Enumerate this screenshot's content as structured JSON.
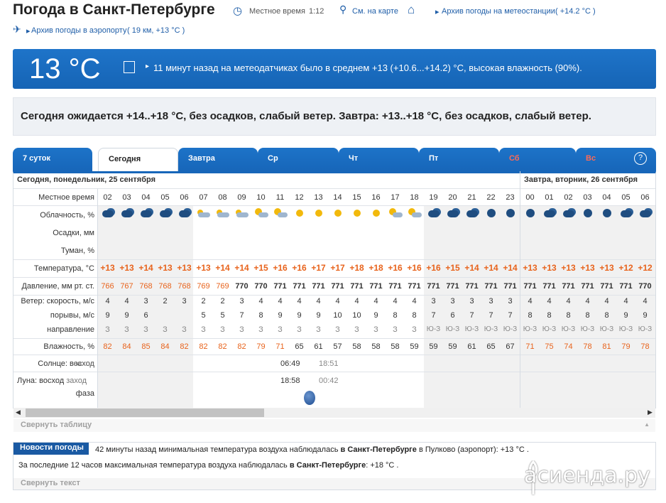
{
  "header": {
    "title": "Погода в Санкт-Петербурге",
    "local_time_label": "Местное время",
    "local_time": "1:12",
    "map_link": "См. на карте",
    "archive_station_link": "Архив погоды на метеостанции",
    "archive_station_temp": "( +14.2 °C )",
    "archive_airport_link": "Архив погоды в аэропорту",
    "archive_airport_note": "( 19 км, +13 °C )"
  },
  "current": {
    "temp": "13 °C",
    "text": "11 минут назад на метеодатчиках было в среднем +13 (+10.6...+14.2) °C, высокая влажность (90%)."
  },
  "forecast_text": "Сегодня ожидается +14..+18 °C, без осадков, слабый ветер. Завтра: +13..+18 °C, без осадков, слабый ветер.",
  "tabs": [
    "7 суток",
    "Сегодня",
    "Завтра",
    "Ср",
    "Чт",
    "Пт",
    "Сб",
    "Вс"
  ],
  "help_icon": "?",
  "table": {
    "day1_header": "Сегодня, понедельник, 25 сентября",
    "day2_header": "Завтра, вторник, 26 сентября",
    "row_labels": {
      "time": "Местное время",
      "clouds": "Облачность, %",
      "precip": "Осадки, мм",
      "fog": "Туман, %",
      "temp": "Температура, °C",
      "pressure": "Давление, мм рт. ст.",
      "wind_speed": "Ветер: скорость, м/с",
      "gusts": "порывы, м/с",
      "direction": "направление",
      "humidity": "Влажность, %",
      "sun_prefix": "Солнце:",
      "sun_rise": "восход",
      "sun_set": "заход",
      "moon_prefix": "Луна:",
      "moon_rise": "восход",
      "moon_set": "заход",
      "phase": "фаза"
    },
    "hours": [
      "02",
      "03",
      "04",
      "05",
      "06",
      "07",
      "08",
      "09",
      "10",
      "11",
      "12",
      "13",
      "14",
      "15",
      "16",
      "17",
      "18",
      "19",
      "20",
      "21",
      "22",
      "23",
      "00",
      "01",
      "02",
      "03",
      "04",
      "05",
      "06"
    ],
    "cloud_icons": [
      "cloudy-night",
      "cloudy-night",
      "cloudy-night",
      "cloudy-night",
      "cloudy-night",
      "partly-cloudy",
      "partly-cloudy",
      "partly-cloudy",
      "sun-cloud",
      "sun-cloud",
      "sun",
      "sun",
      "sun",
      "sun",
      "sun",
      "sun-cloud",
      "sun-cloud",
      "cloudy-night",
      "cloudy-night",
      "cloudy-night",
      "clear-night",
      "clear-night",
      "clear-night",
      "cloudy-night",
      "cloudy-night",
      "clear-night",
      "clear-night",
      "cloudy-night",
      "cloudy-night"
    ],
    "temps": [
      "+13",
      "+13",
      "+14",
      "+13",
      "+13",
      "+13",
      "+14",
      "+14",
      "+15",
      "+16",
      "+16",
      "+17",
      "+17",
      "+18",
      "+18",
      "+16",
      "+16",
      "+16",
      "+15",
      "+14",
      "+14",
      "+14",
      "+13",
      "+13",
      "+13",
      "+13",
      "+13",
      "+12",
      "+12"
    ],
    "pressure": [
      "766",
      "767",
      "768",
      "768",
      "768",
      "769",
      "769",
      "770",
      "770",
      "771",
      "771",
      "771",
      "771",
      "771",
      "771",
      "771",
      "771",
      "771",
      "771",
      "771",
      "771",
      "771",
      "771",
      "771",
      "771",
      "771",
      "771",
      "771",
      "770"
    ],
    "wind_speed": [
      "4",
      "4",
      "3",
      "2",
      "3",
      "2",
      "2",
      "3",
      "4",
      "4",
      "4",
      "4",
      "4",
      "4",
      "4",
      "4",
      "4",
      "3",
      "3",
      "3",
      "3",
      "3",
      "4",
      "4",
      "4",
      "4",
      "4",
      "4",
      "4"
    ],
    "gusts": [
      "9",
      "9",
      "6",
      "",
      "",
      "5",
      "5",
      "7",
      "8",
      "9",
      "9",
      "9",
      "10",
      "10",
      "9",
      "8",
      "8",
      "7",
      "6",
      "7",
      "7",
      "7",
      "8",
      "8",
      "8",
      "8",
      "8",
      "9",
      "9"
    ],
    "direction": [
      "З",
      "З",
      "З",
      "З",
      "З",
      "З",
      "З",
      "З",
      "З",
      "З",
      "З",
      "З",
      "З",
      "З",
      "З",
      "З",
      "З",
      "Ю-З",
      "Ю-З",
      "Ю-З",
      "Ю-З",
      "Ю-З",
      "Ю-З",
      "Ю-З",
      "Ю-З",
      "Ю-З",
      "Ю-З",
      "Ю-З",
      "Ю-З"
    ],
    "humidity": [
      "82",
      "84",
      "85",
      "84",
      "82",
      "82",
      "82",
      "82",
      "79",
      "71",
      "65",
      "61",
      "57",
      "58",
      "58",
      "58",
      "59",
      "59",
      "59",
      "61",
      "65",
      "67",
      "71",
      "75",
      "74",
      "78",
      "81",
      "79",
      "78"
    ],
    "sunrise": "06:49",
    "sunset": "18:51",
    "moonrise": "18:58",
    "moonset": "00:42"
  },
  "collapse_table": "Свернуть таблицу",
  "news": {
    "badge": "Новости погоды",
    "line1_a": "42 минуты назад минимальная температура воздуха наблюдалась",
    "line1_city": "в Санкт-Петербурге",
    "line1_b": "в Пулково (аэропорт): +13 °C .",
    "line2_a": "За последние 12 часов максимальная температура воздуха наблюдалась",
    "line2_city": "в Санкт-Петербурге",
    "line2_b": ": +18 °C ."
  },
  "collapse_text": "Свернуть текст",
  "watermark": "асиенда.ру",
  "colors": {
    "brand_blue": "#1766b9",
    "temp_orange": "#e8631c",
    "weekend_red": "#ff6a55"
  }
}
